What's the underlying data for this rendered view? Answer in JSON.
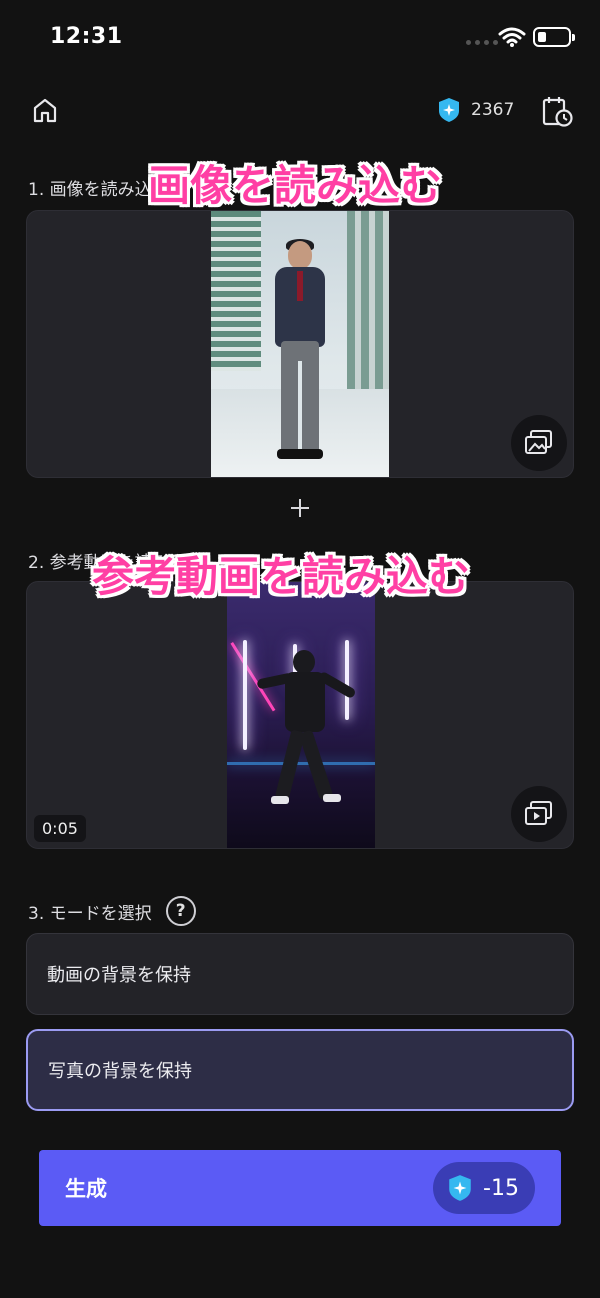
{
  "status_bar": {
    "time": "12:31"
  },
  "header": {
    "credits": "2367"
  },
  "sections": {
    "image": {
      "label": "1. 画像を読み込む",
      "overlay": "画像を読み込む"
    },
    "video": {
      "label": "2. 参考動画を読み込む",
      "overlay": "参考動画を読み込む",
      "duration": "0:05"
    },
    "mode": {
      "label": "3. モードを選択",
      "help": "?",
      "options": [
        {
          "label": "動画の背景を保持",
          "selected": false
        },
        {
          "label": "写真の背景を保持",
          "selected": true
        }
      ]
    }
  },
  "generate": {
    "label": "生成",
    "cost": "-15"
  },
  "colors": {
    "accent": "#5b5bf5",
    "overlay_text": "#ff3fa4",
    "background": "#121212",
    "badge": "#35b8f0"
  },
  "icons": [
    "home-icon",
    "credit-badge-icon",
    "history-icon",
    "change-image-icon",
    "change-video-icon",
    "plus-icon",
    "help-icon",
    "wifi-icon",
    "battery-icon"
  ]
}
